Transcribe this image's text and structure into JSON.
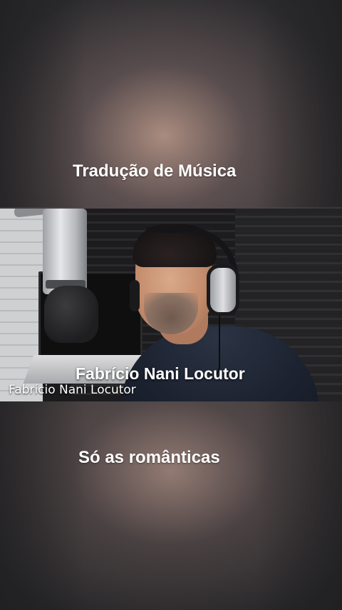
{
  "captions": {
    "top": "Tradução de Música",
    "bottom": "Só as românticas"
  },
  "video": {
    "overlay_name": "Fabrício Nani Locutor",
    "watermark": "Fabrício Nani Locutor"
  },
  "colors": {
    "caption_text": "#ffffff",
    "background": "#2e2e30"
  }
}
